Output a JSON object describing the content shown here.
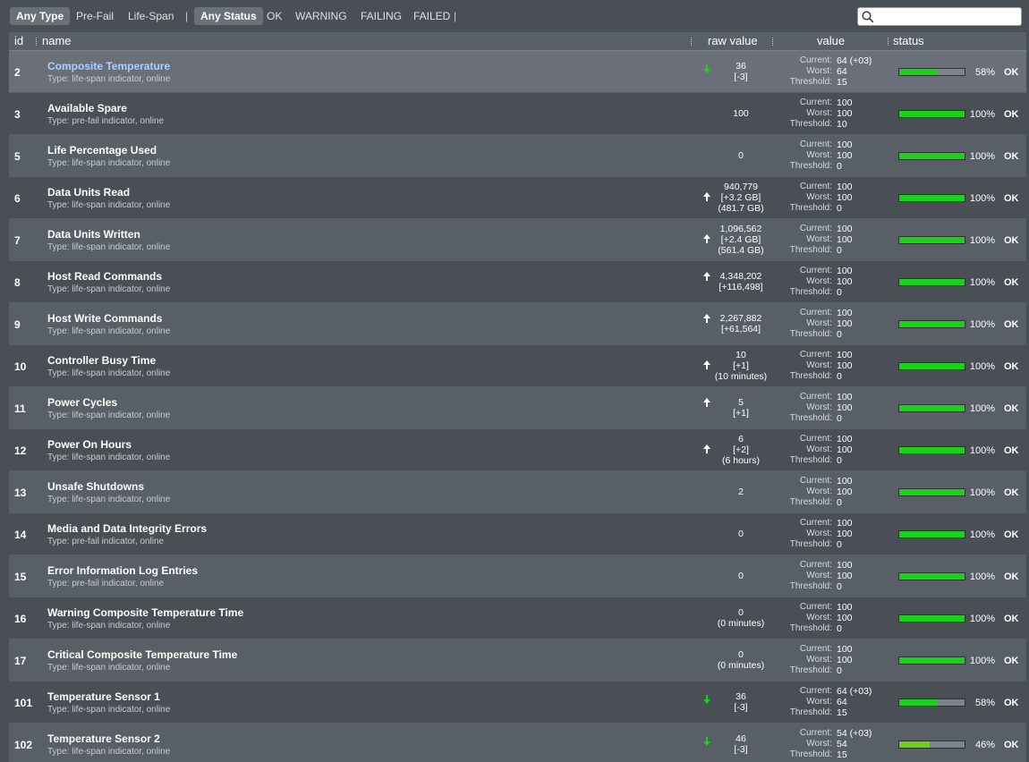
{
  "toolbar": {
    "type_filters": [
      "Any Type",
      "Pre-Fail",
      "Life-Span"
    ],
    "status_filters": [
      "Any Status",
      "OK",
      "WARNING",
      "FAILING",
      "FAILED"
    ],
    "separator": "|",
    "search_placeholder": ""
  },
  "table": {
    "headers": {
      "id": "id",
      "name": "name",
      "raw": "raw value",
      "value": "value",
      "status": "status"
    },
    "value_labels": {
      "current": "Current:",
      "worst": "Worst:",
      "threshold": "Threshold:"
    },
    "rows": [
      {
        "id": "2",
        "name": "Composite Temperature",
        "type": "Type: life-span indicator, online",
        "trend": "down",
        "raw": [
          "36",
          "[-3]"
        ],
        "current": "64  (+03)",
        "worst": "64",
        "threshold": "15",
        "pct": 58,
        "pct_label": "58%",
        "status": "OK",
        "selected": true
      },
      {
        "id": "3",
        "name": "Available Spare",
        "type": "Type: pre-fail indicator, online",
        "trend": "",
        "raw": [
          "100"
        ],
        "current": "100",
        "worst": "100",
        "threshold": "10",
        "pct": 100,
        "pct_label": "100%",
        "status": "OK"
      },
      {
        "id": "5",
        "name": "Life Percentage Used",
        "type": "Type: life-span indicator, online",
        "trend": "",
        "raw": [
          "0"
        ],
        "current": "100",
        "worst": "100",
        "threshold": "0",
        "pct": 100,
        "pct_label": "100%",
        "status": "OK"
      },
      {
        "id": "6",
        "name": "Data Units Read",
        "type": "Type: life-span indicator, online",
        "trend": "up",
        "raw": [
          "940,779",
          "[+3.2 GB]",
          "(481.7 GB)"
        ],
        "current": "100",
        "worst": "100",
        "threshold": "0",
        "pct": 100,
        "pct_label": "100%",
        "status": "OK"
      },
      {
        "id": "7",
        "name": "Data Units Written",
        "type": "Type: life-span indicator, online",
        "trend": "up",
        "raw": [
          "1,096,562",
          "[+2.4 GB]",
          "(561.4 GB)"
        ],
        "current": "100",
        "worst": "100",
        "threshold": "0",
        "pct": 100,
        "pct_label": "100%",
        "status": "OK"
      },
      {
        "id": "8",
        "name": "Host Read Commands",
        "type": "Type: life-span indicator, online",
        "trend": "up",
        "raw": [
          "4,348,202",
          "[+116,498]"
        ],
        "current": "100",
        "worst": "100",
        "threshold": "0",
        "pct": 100,
        "pct_label": "100%",
        "status": "OK"
      },
      {
        "id": "9",
        "name": "Host Write Commands",
        "type": "Type: life-span indicator, online",
        "trend": "up",
        "raw": [
          "2,267,882",
          "[+61,564]"
        ],
        "current": "100",
        "worst": "100",
        "threshold": "0",
        "pct": 100,
        "pct_label": "100%",
        "status": "OK"
      },
      {
        "id": "10",
        "name": "Controller Busy Time",
        "type": "Type: life-span indicator, online",
        "trend": "up",
        "raw": [
          "10",
          "[+1]",
          "(10 minutes)"
        ],
        "current": "100",
        "worst": "100",
        "threshold": "0",
        "pct": 100,
        "pct_label": "100%",
        "status": "OK"
      },
      {
        "id": "11",
        "name": "Power Cycles",
        "type": "Type: life-span indicator, online",
        "trend": "up",
        "raw": [
          "5",
          "[+1]"
        ],
        "current": "100",
        "worst": "100",
        "threshold": "0",
        "pct": 100,
        "pct_label": "100%",
        "status": "OK"
      },
      {
        "id": "12",
        "name": "Power On Hours",
        "type": "Type: life-span indicator, online",
        "trend": "up",
        "raw": [
          "6",
          "[+2]",
          "(6 hours)"
        ],
        "current": "100",
        "worst": "100",
        "threshold": "0",
        "pct": 100,
        "pct_label": "100%",
        "status": "OK"
      },
      {
        "id": "13",
        "name": "Unsafe Shutdowns",
        "type": "Type: life-span indicator, online",
        "trend": "",
        "raw": [
          "2"
        ],
        "current": "100",
        "worst": "100",
        "threshold": "0",
        "pct": 100,
        "pct_label": "100%",
        "status": "OK"
      },
      {
        "id": "14",
        "name": "Media and Data Integrity Errors",
        "type": "Type: pre-fail indicator, online",
        "trend": "",
        "raw": [
          "0"
        ],
        "current": "100",
        "worst": "100",
        "threshold": "0",
        "pct": 100,
        "pct_label": "100%",
        "status": "OK"
      },
      {
        "id": "15",
        "name": "Error Information Log Entries",
        "type": "Type: pre-fail indicator, online",
        "trend": "",
        "raw": [
          "0"
        ],
        "current": "100",
        "worst": "100",
        "threshold": "0",
        "pct": 100,
        "pct_label": "100%",
        "status": "OK"
      },
      {
        "id": "16",
        "name": "Warning Composite Temperature Time",
        "type": "Type: life-span indicator, online",
        "trend": "",
        "raw": [
          "0",
          "(0 minutes)"
        ],
        "current": "100",
        "worst": "100",
        "threshold": "0",
        "pct": 100,
        "pct_label": "100%",
        "status": "OK"
      },
      {
        "id": "17",
        "name": "Critical Composite Temperature Time",
        "type": "Type: life-span indicator, online",
        "trend": "",
        "raw": [
          "0",
          "(0 minutes)"
        ],
        "current": "100",
        "worst": "100",
        "threshold": "0",
        "pct": 100,
        "pct_label": "100%",
        "status": "OK"
      },
      {
        "id": "101",
        "name": "Temperature Sensor 1",
        "type": "Type: life-span indicator, online",
        "trend": "down",
        "raw": [
          "36",
          "[-3]"
        ],
        "current": "64  (+03)",
        "worst": "64",
        "threshold": "15",
        "pct": 58,
        "pct_label": "58%",
        "status": "OK"
      },
      {
        "id": "102",
        "name": "Temperature Sensor 2",
        "type": "Type: life-span indicator, online",
        "trend": "down",
        "raw": [
          "46",
          "[-3]"
        ],
        "current": "54  (+03)",
        "worst": "54",
        "threshold": "15",
        "pct": 46,
        "pct_label": "46%",
        "status": "OK"
      }
    ]
  },
  "colors": {
    "bar_fill": "#19d219",
    "bar_fill_partial": "#6bd11c",
    "bar_track": "#7e848c",
    "trend_down": "#19d219",
    "trend_up": "#ffffff",
    "selected_name": "#a9d1ff"
  },
  "icons": {
    "search": "search-icon",
    "trend_up": "arrow-up-icon",
    "trend_down": "arrow-down-icon"
  }
}
